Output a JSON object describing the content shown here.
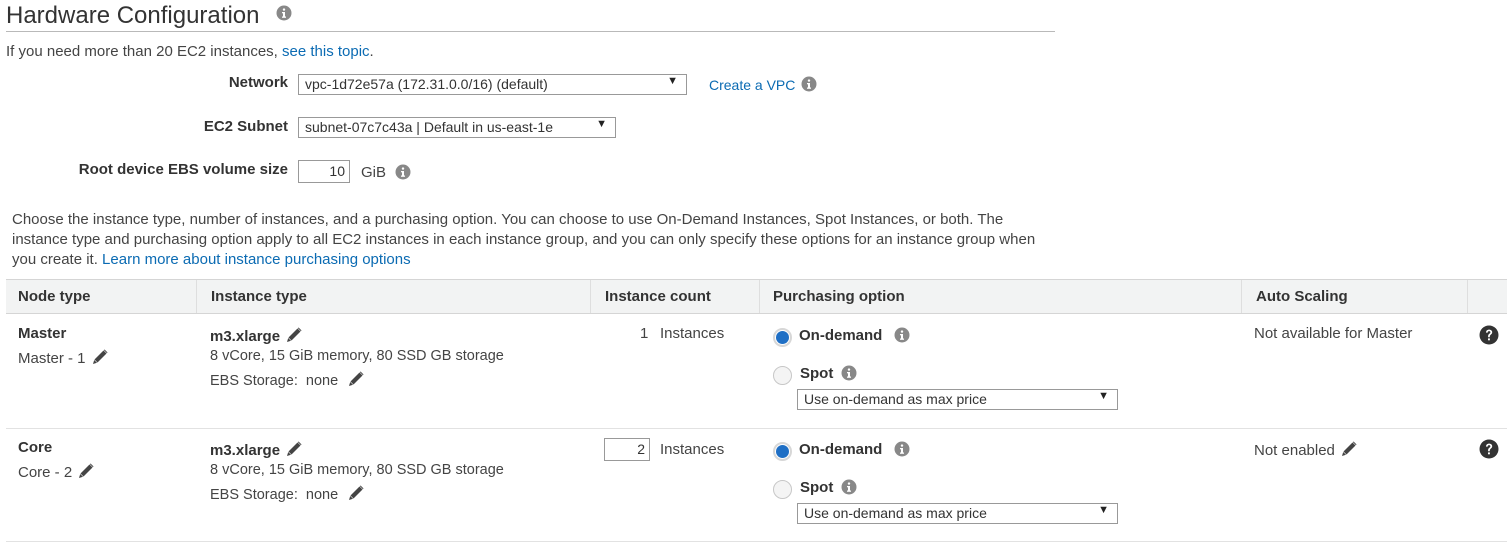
{
  "section": {
    "title": "Hardware Configuration",
    "intro_text": "If you need more than 20 EC2 instances, ",
    "intro_link": "see this topic",
    "intro_end": "."
  },
  "network": {
    "label": "Network",
    "value": "vpc-1d72e57a (172.31.0.0/16) (default)",
    "create_link": "Create a VPC"
  },
  "subnet": {
    "label": "EC2 Subnet",
    "value": "subnet-07c7c43a | Default in us-east-1e"
  },
  "ebs": {
    "label": "Root device EBS volume size",
    "value": "10",
    "unit": "GiB"
  },
  "description": {
    "text": "Choose the instance type, number of instances, and a purchasing option. You can choose to use On-Demand Instances, Spot Instances, or both. The instance type and purchasing option apply to all EC2 instances in each instance group, and you can only specify these options for an instance group when you create it. ",
    "link": "Learn more about instance purchasing options"
  },
  "table": {
    "headers": {
      "node_type": "Node type",
      "instance_type": "Instance type",
      "instance_count": "Instance count",
      "purchasing_option": "Purchasing option",
      "auto_scaling": "Auto Scaling"
    },
    "rows": [
      {
        "node_type": "Master",
        "node_name": "Master - 1",
        "instance_type": "m3.xlarge",
        "specs": "8 vCore, 15 GiB memory, 80 SSD GB storage",
        "ebs_label": "EBS Storage:",
        "ebs_value": "none",
        "count": "1",
        "count_editable": false,
        "count_unit": "Instances",
        "on_demand_label": "On-demand",
        "spot_label": "Spot",
        "selected_option": "On-demand",
        "spot_price": "Use on-demand as max price",
        "auto_scaling": "Not available for Master"
      },
      {
        "node_type": "Core",
        "node_name": "Core - 2",
        "instance_type": "m3.xlarge",
        "specs": "8 vCore, 15 GiB memory, 80 SSD GB storage",
        "ebs_label": "EBS Storage:",
        "ebs_value": "none",
        "count": "2",
        "count_editable": true,
        "count_unit": "Instances",
        "on_demand_label": "On-demand",
        "spot_label": "Spot",
        "selected_option": "On-demand",
        "spot_price": "Use on-demand as max price",
        "auto_scaling": "Not enabled"
      }
    ]
  },
  "colors": {
    "link": "#0b6bb3",
    "radio_selected": "#1f6fc5",
    "header_bg": "#f2f3f3",
    "icon_gray": "#888888"
  },
  "icons": {
    "info": "info-icon",
    "edit": "pencil-icon",
    "help": "question-circle-icon",
    "dropdown": "caret-down-icon"
  }
}
